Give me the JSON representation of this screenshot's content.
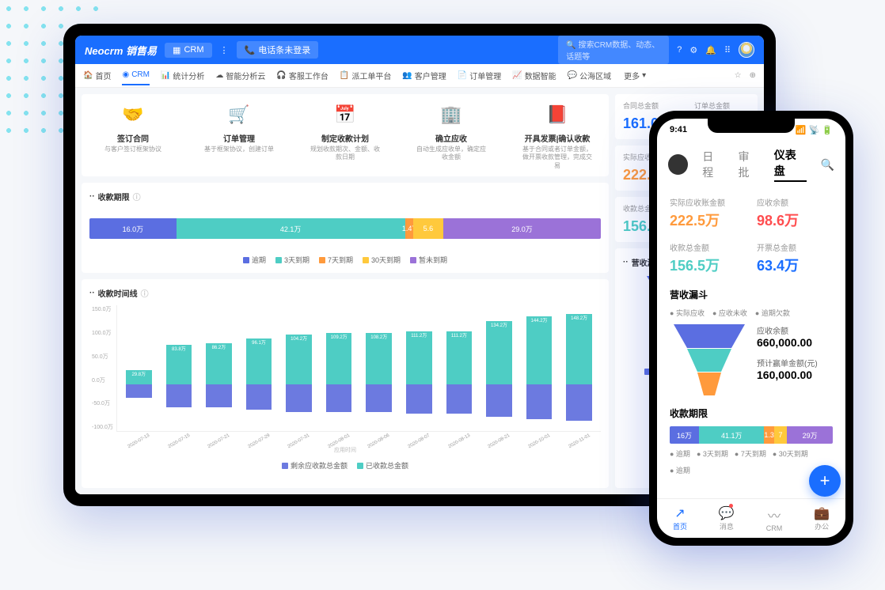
{
  "header": {
    "logo": "Neocrm 销售易",
    "crm_label": "CRM",
    "phone_label": "电话条未登录",
    "search_placeholder": "搜索CRM数据、动态、话题等"
  },
  "nav": {
    "items": [
      "首页",
      "CRM",
      "统计分析",
      "智能分析云",
      "客服工作台",
      "派工单平台",
      "客户管理",
      "订单管理",
      "数据智能",
      "公海区域"
    ],
    "more": "更多"
  },
  "process": [
    {
      "title": "签订合同",
      "desc": "与客户签订框架协议"
    },
    {
      "title": "订单管理",
      "desc": "基于框架协议，创建订单"
    },
    {
      "title": "制定收款计划",
      "desc": "规划收款期次、金额、收款日期"
    },
    {
      "title": "确立应收",
      "desc": "自动生成应收单，确定应收金额"
    },
    {
      "title": "开具发票|确认收款",
      "desc": "基于合同或者订单金额，做开票收款管理，完成交易"
    }
  ],
  "payment_period": {
    "title": "收款期限",
    "legend": [
      "逾期",
      "3天到期",
      "7天到期",
      "30天到期",
      "暂未到期"
    ]
  },
  "timeline": {
    "title": "收款时间线",
    "xaxis_label": "应用时间",
    "legend": [
      "剩余应收款总金额",
      "已收款总金额"
    ]
  },
  "kpis": [
    {
      "label": "合同总金额",
      "value": "161.0万",
      "color": "#1a6eff"
    },
    {
      "label": "订单总金额",
      "value": ""
    },
    {
      "label": "实际应收账金额",
      "value": "222.5万",
      "color": "#ff9a3c"
    },
    {
      "label": "收款总金额",
      "value": "156.5万",
      "color": "#4ecdc4"
    }
  ],
  "funnel": {
    "title": "营收漏斗",
    "legend": [
      "实际应收",
      "应收余额"
    ]
  },
  "chart_data": {
    "payment_period": {
      "type": "bar",
      "series": [
        {
          "name": "逾期",
          "value": 16.0,
          "label": "16.0万",
          "color": "#5b6ee1"
        },
        {
          "name": "3天到期",
          "value": 42.1,
          "label": "42.1万",
          "color": "#4ecdc4"
        },
        {
          "name": "7天到期",
          "value": 1.47,
          "label": "1.47",
          "color": "#ff9a3c"
        },
        {
          "name": "30天到期",
          "value": 5.6,
          "label": "5.6",
          "color": "#ffc93c"
        },
        {
          "name": "暂未到期",
          "value": 29.0,
          "label": "29.0万",
          "color": "#9b72d8"
        }
      ]
    },
    "timeline": {
      "type": "bar",
      "ylim": [
        -100,
        150
      ],
      "yticks": [
        "150.0万",
        "100.0万",
        "50.0万",
        "0.0万",
        "-50.0万",
        "-100.0万"
      ],
      "categories": [
        "2020-07-13",
        "2020-07-15",
        "2020-07-21",
        "2020-07-29",
        "2020-07-31",
        "2020-08-01",
        "2020-08-06",
        "2020-08-07",
        "2020-08-13",
        "2020-08-21",
        "2020-10-01",
        "2020-11-01"
      ],
      "series": [
        {
          "name": "已收款总金额",
          "color": "#4ecdc4",
          "values": [
            29.8,
            83.8,
            86.2,
            96.1,
            104.2,
            109.2,
            108.2,
            111.2,
            111.2,
            134.2,
            144.2,
            148.2
          ],
          "labels": [
            "29.8万",
            "83.8万",
            "86.2万",
            "96.1万",
            "104.2万",
            "109.2万",
            "108.2万",
            "111.2万",
            "111.2万",
            "134.2万",
            "144.2万",
            "148.2万"
          ]
        },
        {
          "name": "剩余应收款总金额",
          "color": "#6c7ae0",
          "values": [
            -29.8,
            -50,
            -50,
            -55,
            -60,
            -60,
            -60,
            -62,
            -62,
            -70,
            -75,
            -78
          ]
        }
      ]
    }
  },
  "phone": {
    "time": "9:41",
    "tabs": [
      "日程",
      "审批",
      "仪表盘"
    ],
    "kpis": [
      {
        "label": "实际应收账金额",
        "value": "222.5万",
        "color": "#ff9a3c"
      },
      {
        "label": "应收余额",
        "value": "98.6万",
        "color": "#ff4d4f"
      },
      {
        "label": "收款总金额",
        "value": "156.5万",
        "color": "#4ecdc4"
      },
      {
        "label": "开票总金额",
        "value": "63.4万",
        "color": "#1a6eff"
      }
    ],
    "funnel": {
      "title": "营收漏斗",
      "legend": [
        "实际应收",
        "应收未收",
        "逾期欠款"
      ],
      "stats": [
        {
          "label": "应收余额",
          "value": "660,000.00"
        },
        {
          "label": "预计赢单金额(元)",
          "value": "160,000.00"
        }
      ]
    },
    "payment": {
      "title": "收款期限",
      "legend": [
        "逾期",
        "3天到期",
        "7天到期",
        "30天到期",
        "逾期"
      ],
      "segments": [
        {
          "label": "16万",
          "color": "#5b6ee1",
          "w": 18
        },
        {
          "label": "41.1万",
          "color": "#4ecdc4",
          "w": 40
        },
        {
          "label": "1.3",
          "color": "#ff9a3c",
          "w": 6
        },
        {
          "label": "7",
          "color": "#ffc93c",
          "w": 8
        },
        {
          "label": "29万",
          "color": "#9b72d8",
          "w": 28
        }
      ]
    },
    "bottom_nav": [
      "首页",
      "消息",
      "CRM",
      "办公"
    ]
  }
}
